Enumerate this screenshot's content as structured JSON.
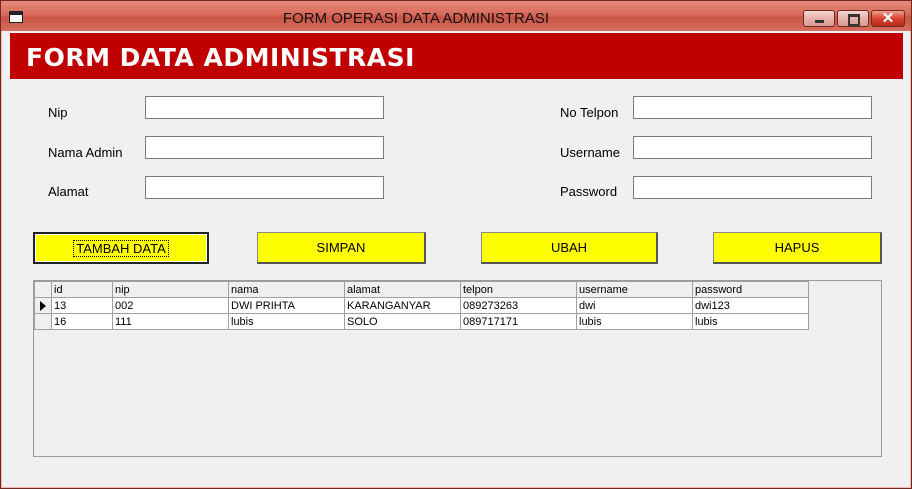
{
  "window": {
    "title": "FORM OPERASI DATA ADMINISTRASI"
  },
  "banner": {
    "title": "FORM DATA ADMINISTRASI"
  },
  "form": {
    "nip": {
      "label": "Nip",
      "value": ""
    },
    "nama_admin": {
      "label": "Nama Admin",
      "value": ""
    },
    "alamat": {
      "label": "Alamat",
      "value": ""
    },
    "no_telpon": {
      "label": "No Telpon",
      "value": ""
    },
    "username": {
      "label": "Username",
      "value": ""
    },
    "password": {
      "label": "Password",
      "value": ""
    }
  },
  "buttons": {
    "tambah": "TAMBAH DATA",
    "simpan": "SIMPAN",
    "ubah": "UBAH",
    "hapus": "HAPUS"
  },
  "grid": {
    "columns": [
      "id",
      "nip",
      "nama",
      "alamat",
      "telpon",
      "username",
      "password"
    ],
    "rows": [
      {
        "id": "13",
        "nip": "002",
        "nama": "DWI PRIHTA",
        "alamat": "KARANGANYAR",
        "telpon": "089273263",
        "username": "dwi",
        "password": "dwi123",
        "current": true
      },
      {
        "id": "16",
        "nip": "111",
        "nama": "lubis",
        "alamat": "SOLO",
        "telpon": "089717171",
        "username": "lubis",
        "password": "lubis",
        "current": false
      }
    ]
  },
  "colors": {
    "banner": "#c00000",
    "button": "#ffff00"
  },
  "icons": [
    "app-icon",
    "minimize-icon",
    "maximize-icon",
    "close-icon",
    "row-pointer-icon"
  ]
}
